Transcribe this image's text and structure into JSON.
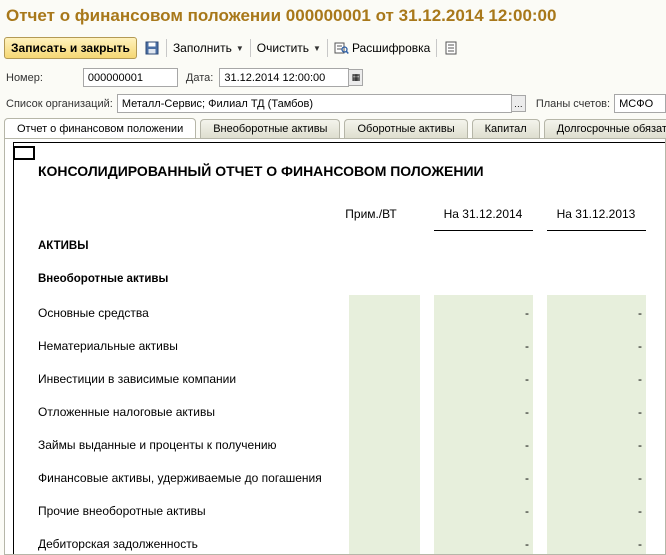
{
  "window": {
    "title": "Отчет о финансовом положении 000000001 от 31.12.2014 12:00:00"
  },
  "toolbar": {
    "save_close": "Записать и закрыть",
    "fill": "Заполнить",
    "clear": "Очистить",
    "decode": "Расшифровка"
  },
  "form": {
    "number_label": "Номер:",
    "number_value": "000000001",
    "date_label": "Дата:",
    "date_value": "31.12.2014 12:00:00",
    "orgs_label": "Список организаций:",
    "orgs_value": "Металл-Сервис; Филиал ТД (Тамбов)",
    "plans_label": "Планы счетов:",
    "plans_value": "МСФО"
  },
  "tabs": [
    {
      "label": "Отчет о финансовом положении",
      "active": true
    },
    {
      "label": "Внеоборотные активы"
    },
    {
      "label": "Оборотные активы"
    },
    {
      "label": "Капитал"
    },
    {
      "label": "Долгосрочные обязат"
    }
  ],
  "report": {
    "title": "КОНСОЛИДИРОВАННЫЙ ОТЧЕТ О ФИНАНСОВОМ ПОЛОЖЕНИИ",
    "columns": [
      "Прим./ВТ",
      "На 31.12.2014",
      "На 31.12.2013"
    ],
    "sections": [
      "АКТИВЫ",
      "Внеоборотные активы"
    ],
    "rows": [
      {
        "label": "Основные средства",
        "v2014": "-",
        "v2013": "-"
      },
      {
        "label": "Нематериальные активы",
        "v2014": "-",
        "v2013": "-"
      },
      {
        "label": "Инвестиции в зависимые компании",
        "v2014": "-",
        "v2013": "-"
      },
      {
        "label": "Отложенные налоговые активы",
        "v2014": "-",
        "v2013": "-"
      },
      {
        "label": "Займы выданные и проценты к получению",
        "v2014": "-",
        "v2013": "-"
      },
      {
        "label": "Финансовые активы, удерживаемые до погашения",
        "v2014": "-",
        "v2013": "-"
      },
      {
        "label": "Прочие внеоборотные активы",
        "v2014": "-",
        "v2013": "-"
      },
      {
        "label": "Дебиторская задолженность",
        "v2014": "-",
        "v2013": "-"
      }
    ]
  },
  "colors": {
    "title": "#a8781a",
    "primary_button": "#f5d774",
    "band": "#e7efdc"
  }
}
